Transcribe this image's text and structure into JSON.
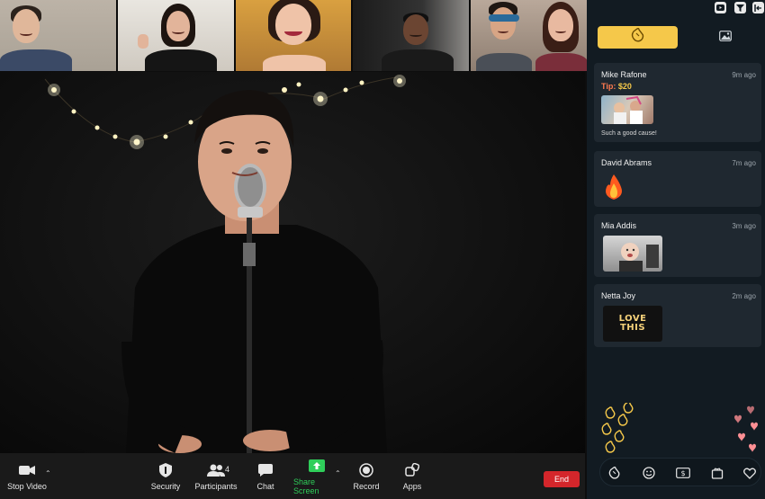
{
  "toolbar": {
    "stop_video": "Stop Video",
    "security": "Security",
    "participants": "Participants",
    "participants_count": "4",
    "chat": "Chat",
    "share_screen": "Share Screen",
    "record": "Record",
    "apps": "Apps",
    "end": "End"
  },
  "panel": {
    "tabs": [
      {
        "icon": "clap-icon",
        "active": true
      },
      {
        "icon": "image-icon",
        "active": false
      }
    ],
    "feed": [
      {
        "name": "Mike Rafone",
        "time": "9m ago",
        "tip_label": "Tip:",
        "tip_amount": "$20",
        "message": "Such a good cause!",
        "media": "photo"
      },
      {
        "name": "David Abrams",
        "time": "7m ago",
        "media": "fire-emoji"
      },
      {
        "name": "Mia Addis",
        "time": "3m ago",
        "media": "gif"
      },
      {
        "name": "Netta Joy",
        "time": "2m ago",
        "media": "sticker",
        "sticker_text_1": "LOVE",
        "sticker_text_2": "THIS"
      }
    ],
    "reaction_bar": [
      "clap-icon",
      "smiley-icon",
      "dollar-icon",
      "gift-icon",
      "heart-icon"
    ]
  },
  "colors": {
    "accent_yellow": "#f5c84a",
    "end_red": "#d4262b",
    "share_green": "#2fce5a",
    "panel_bg": "#121b22",
    "card_bg": "#1f2830"
  }
}
